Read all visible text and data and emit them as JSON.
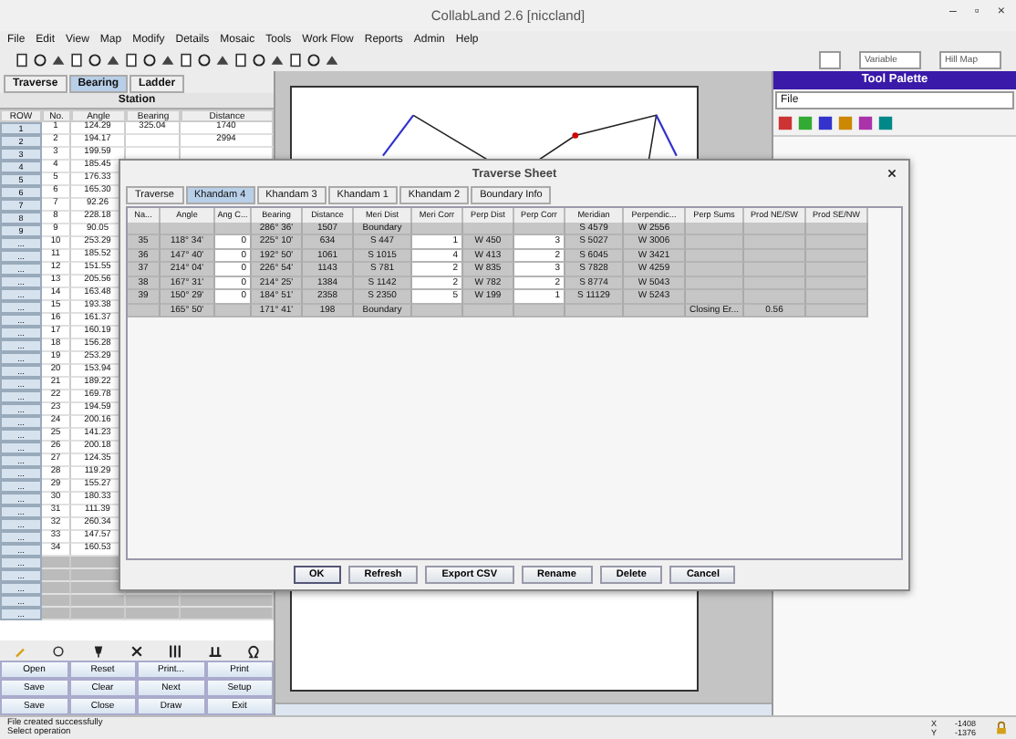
{
  "window": {
    "title": "CollabLand 2.6 [niccland]",
    "controls": [
      "–",
      "▫",
      "×"
    ]
  },
  "menu": [
    "File",
    "Edit",
    "View",
    "Map",
    "Modify",
    "Details",
    "Mosaic",
    "Tools",
    "Work Flow",
    "Reports",
    "Admin",
    "Help"
  ],
  "toolbar": {
    "combos": [
      {
        "value": "Variable"
      },
      {
        "value": "Hill Map"
      }
    ]
  },
  "left_panel": {
    "tabs": [
      {
        "label": "Traverse",
        "selected": false
      },
      {
        "label": "Bearing",
        "selected": true
      },
      {
        "label": "Ladder",
        "selected": false
      }
    ],
    "group_header": "Station",
    "columns": [
      "ROW",
      "No.",
      "Angle",
      "Bearing",
      "Distance"
    ],
    "rows": [
      {
        "row": "1",
        "no": "1",
        "angle": "124.29",
        "bearing": "325.04",
        "distance": "1740"
      },
      {
        "row": "2",
        "no": "2",
        "angle": "194.17",
        "distance": "2994"
      },
      {
        "row": "3",
        "no": "3",
        "angle": "199.59"
      },
      {
        "row": "4",
        "no": "4",
        "angle": "185.45"
      },
      {
        "row": "5",
        "no": "5",
        "angle": "176.33"
      },
      {
        "row": "6",
        "no": "6",
        "angle": "165.30"
      },
      {
        "row": "7",
        "no": "7",
        "angle": "92.26"
      },
      {
        "row": "8",
        "no": "8",
        "angle": "228.18"
      },
      {
        "row": "9",
        "no": "9",
        "angle": "90.05"
      },
      {
        "row": "...",
        "no": "10",
        "angle": "253.29"
      },
      {
        "row": "...",
        "no": "11",
        "angle": "185.52"
      },
      {
        "row": "...",
        "no": "12",
        "angle": "151.55"
      },
      {
        "row": "...",
        "no": "13",
        "angle": "205.56"
      },
      {
        "row": "...",
        "no": "14",
        "angle": "163.48"
      },
      {
        "row": "...",
        "no": "15",
        "angle": "193.38"
      },
      {
        "row": "...",
        "no": "16",
        "angle": "161.37"
      },
      {
        "row": "...",
        "no": "17",
        "angle": "160.19"
      },
      {
        "row": "...",
        "no": "18",
        "angle": "156.28"
      },
      {
        "row": "...",
        "no": "19",
        "angle": "253.29"
      },
      {
        "row": "...",
        "no": "20",
        "angle": "153.94"
      },
      {
        "row": "...",
        "no": "21",
        "angle": "189.22"
      },
      {
        "row": "...",
        "no": "22",
        "angle": "169.78"
      },
      {
        "row": "...",
        "no": "23",
        "angle": "194.59"
      },
      {
        "row": "...",
        "no": "24",
        "angle": "200.16"
      },
      {
        "row": "...",
        "no": "25",
        "angle": "141.23"
      },
      {
        "row": "...",
        "no": "26",
        "angle": "200.18"
      },
      {
        "row": "...",
        "no": "27",
        "angle": "124.35"
      },
      {
        "row": "...",
        "no": "28",
        "angle": "119.29"
      },
      {
        "row": "...",
        "no": "29",
        "angle": "155.27"
      },
      {
        "row": "...",
        "no": "30",
        "angle": "180.33"
      },
      {
        "row": "...",
        "no": "31",
        "angle": "111.39"
      },
      {
        "row": "...",
        "no": "32",
        "angle": "260.34"
      },
      {
        "row": "...",
        "no": "33",
        "angle": "147.57"
      },
      {
        "row": "...",
        "no": "34",
        "angle": "160.53"
      },
      {
        "row": "..."
      },
      {
        "row": "..."
      },
      {
        "row": "..."
      },
      {
        "row": "..."
      },
      {
        "row": "..."
      }
    ],
    "buttons": [
      [
        "Open",
        "Reset",
        "Print...",
        "Print"
      ],
      [
        "Save",
        "Clear",
        "Next",
        "Setup"
      ],
      [
        "Save",
        "Close",
        "Draw",
        "Exit"
      ]
    ]
  },
  "tool_palette": {
    "title": "Tool Palette",
    "dropdown": "File"
  },
  "dialog": {
    "title": "Traverse Sheet",
    "tabs": [
      {
        "label": "Traverse",
        "selected": false
      },
      {
        "label": "Khandam 4",
        "selected": true
      },
      {
        "label": "Khandam 3",
        "selected": false
      },
      {
        "label": "Khandam 1",
        "selected": false
      },
      {
        "label": "Khandam 2",
        "selected": false
      },
      {
        "label": "Boundary Info",
        "selected": false
      }
    ],
    "columns": [
      {
        "label": "Na...",
        "kind": "plain"
      },
      {
        "label": "Angle",
        "kind": "plain"
      },
      {
        "label": "Ang C...",
        "kind": "correction"
      },
      {
        "label": "Bearing",
        "kind": "plain"
      },
      {
        "label": "Distance",
        "kind": "plain"
      },
      {
        "label": "Meri Dist",
        "kind": "plain"
      },
      {
        "label": "Meri Corr",
        "kind": "correction"
      },
      {
        "label": "Perp Dist",
        "kind": "plain"
      },
      {
        "label": "Perp Corr",
        "kind": "correction"
      },
      {
        "label": "Meridian",
        "kind": "plain"
      },
      {
        "label": "Perpendic...",
        "kind": "plain"
      },
      {
        "label": "Perp Sums",
        "kind": "plain"
      },
      {
        "label": "Prod NE/SW",
        "kind": "plain"
      },
      {
        "label": "Prod SE/NW",
        "kind": "plain"
      }
    ],
    "rows": [
      {
        "editable": false,
        "bearing": "286° 36'",
        "distance": "1507",
        "meri_dist": "Boundary",
        "meridian": "S 4579",
        "perpendic": "W 2556"
      },
      {
        "editable": true,
        "na": "35",
        "angle": "118° 34'",
        "ang_c": "0",
        "bearing": "225° 10'",
        "distance": "634",
        "meri_dist": "S 447",
        "meri_corr": "1",
        "perp_dist": "W 450",
        "perp_corr": "3",
        "meridian": "S 5027",
        "perpendic": "W 3006"
      },
      {
        "editable": true,
        "na": "36",
        "angle": "147° 40'",
        "ang_c": "0",
        "bearing": "192° 50'",
        "distance": "1061",
        "meri_dist": "S 1015",
        "meri_corr": "4",
        "perp_dist": "W 413",
        "perp_corr": "2",
        "meridian": "S 6045",
        "perpendic": "W 3421"
      },
      {
        "editable": true,
        "na": "37",
        "angle": "214° 04'",
        "ang_c": "0",
        "bearing": "226° 54'",
        "distance": "1143",
        "meri_dist": "S 781",
        "meri_corr": "2",
        "perp_dist": "W 835",
        "perp_corr": "3",
        "meridian": "S 7828",
        "perpendic": "W 4259"
      },
      {
        "editable": true,
        "na": "38",
        "angle": "167° 31'",
        "ang_c": "0",
        "bearing": "214° 25'",
        "distance": "1384",
        "meri_dist": "S 1142",
        "meri_corr": "2",
        "perp_dist": "W 782",
        "perp_corr": "2",
        "meridian": "S 8774",
        "perpendic": "W 5043"
      },
      {
        "editable": true,
        "na": "39",
        "angle": "150° 29'",
        "ang_c": "0",
        "bearing": "184° 51'",
        "distance": "2358",
        "meri_dist": "S 2350",
        "meri_corr": "5",
        "perp_dist": "W 199",
        "perp_corr": "1",
        "meridian": "S 11129",
        "perpendic": "W 5243"
      },
      {
        "editable": false,
        "angle": "165° 50'",
        "bearing": "171° 41'",
        "distance": "198",
        "meri_dist": "Boundary",
        "perp_sums": "Closing Er...",
        "prod_ne_sw": "0.56"
      }
    ],
    "buttons": [
      "OK",
      "Refresh",
      "Export CSV",
      "Rename",
      "Delete",
      "Cancel"
    ]
  },
  "status_bar": {
    "messages": [
      "File created successfully",
      "Select operation"
    ],
    "x_label": "X",
    "y_label": "Y",
    "x_value": "-1408",
    "y_value": "-1376"
  }
}
